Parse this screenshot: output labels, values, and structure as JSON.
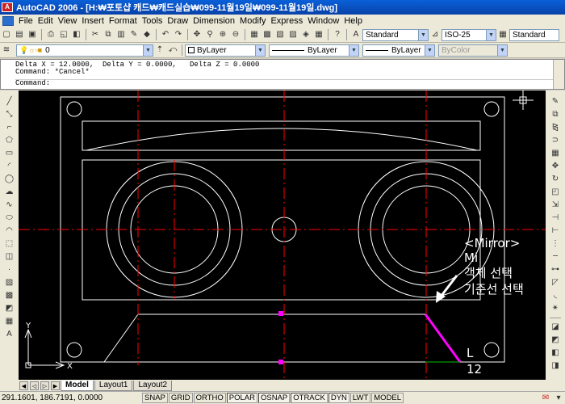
{
  "window": {
    "title": "AutoCAD 2006 - [H:₩포토샵 캐드₩캐드실습₩099-11월19일₩099-11월19일.dwg]",
    "app_icon_label": "A"
  },
  "menu": {
    "items": [
      "File",
      "Edit",
      "View",
      "Insert",
      "Format",
      "Tools",
      "Draw",
      "Dimension",
      "Modify",
      "Express",
      "Window",
      "Help"
    ]
  },
  "toolbar1": {
    "text_style": "Standard",
    "dim_style": "ISO-25",
    "table_style": "Standard"
  },
  "toolbar2": {
    "layer": "0",
    "color": "ByLayer",
    "linetype": "ByLayer",
    "lineweight": "ByLayer",
    "plot_style": "ByColor"
  },
  "command": {
    "history": [
      "Delta X = 12.0000,  Delta Y = 0.0000,   Delta Z = 0.0000",
      "Command: *Cancel*"
    ],
    "prompt": "Command:"
  },
  "annotations": {
    "mirror_title": "<Mirror>",
    "mi": "Mi",
    "select_objects": "객체 선택",
    "select_baseline": "기준선 선택",
    "L": "L",
    "twelve": "12"
  },
  "ucs": {
    "x": "X",
    "y": "Y"
  },
  "tabs": [
    "Model",
    "Layout1",
    "Layout2"
  ],
  "status": {
    "coords": "291.1601, 186.7191, 0.0000",
    "buttons": [
      "SNAP",
      "GRID",
      "ORTHO",
      "POLAR",
      "OSNAP",
      "OTRACK",
      "DYN",
      "LWT",
      "MODEL"
    ],
    "on_buttons": [
      "POLAR",
      "OSNAP",
      "OTRACK",
      "DYN"
    ]
  },
  "colors": {
    "canvas_bg": "#000000",
    "drawing_lines": "#ffffff",
    "center_lines": "#ff0000",
    "grip": "#ff00ff",
    "mirror_line": "#ff00ff",
    "ortho_line": "#00c000",
    "title_bar": "#0a5fd8"
  }
}
